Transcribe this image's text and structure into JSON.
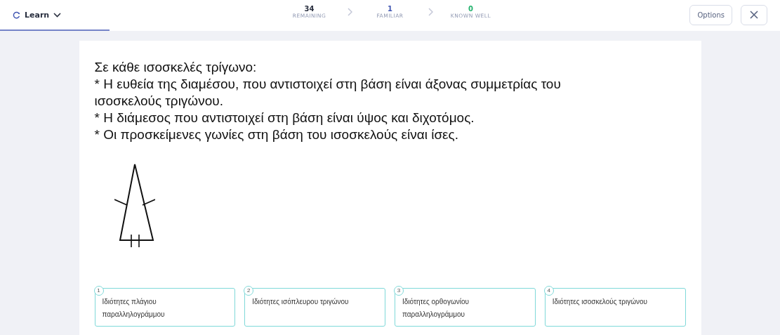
{
  "header": {
    "mode": "Learn",
    "progress": {
      "level": 0.14
    },
    "stats": [
      {
        "count": "34",
        "label": "REMAINING",
        "color": "#282e3e"
      },
      {
        "count": "1",
        "label": "FAMILIAR",
        "color": "#4257b2"
      },
      {
        "count": "0",
        "label": "KNOWN WELL",
        "color": "#23b26d"
      }
    ],
    "options_button": "Options"
  },
  "card": {
    "lines": [
      "Σε κάθε ισοσκελές τρίγωνο:",
      "* Η ευθεία της διαμέσου, που αντιστοιχεί στη βάση είναι άξονας συμμετρίας του ισοσκελούς τριγώνου.",
      "* Η διάμεσος που αντιστοιχεί στη βάση είναι ύψος και διχοτόμος.",
      "* Οι προσκείμενες γωνίες στη βάση του ισοσκελούς είναι ίσες."
    ]
  },
  "choices": [
    {
      "number": "1",
      "text": "Ιδιότητες πλάγιου παραλληλογράμμου"
    },
    {
      "number": "2",
      "text": "Ιδιότητες ισόπλευρου τριγώνου"
    },
    {
      "number": "3",
      "text": "Ιδιότητες ορθογωνίου παραλληλογράμμου"
    },
    {
      "number": "4",
      "text": "Ιδιότητες ισοσκελούς τριγώνου"
    }
  ]
}
